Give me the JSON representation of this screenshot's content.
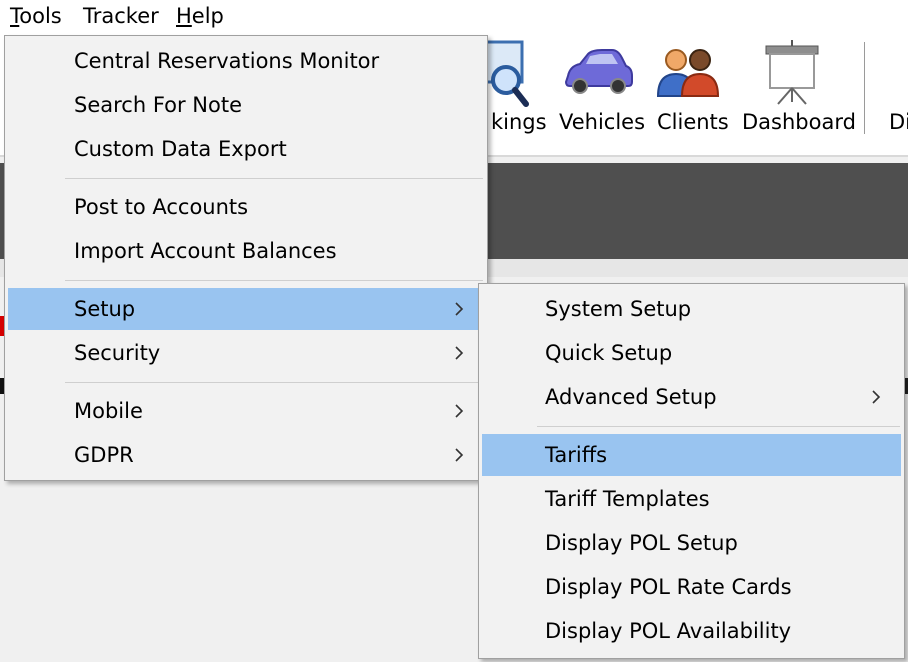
{
  "menubar": {
    "items": [
      {
        "label": "Tools",
        "mnemonic_first": "T",
        "rest": "ools"
      },
      {
        "label": "Tracker"
      },
      {
        "label": "Help",
        "mnemonic_first": "H",
        "rest": "elp"
      }
    ]
  },
  "toolbar": {
    "buttons": [
      {
        "label": "kings",
        "icon": "search-icon"
      },
      {
        "label": "Vehicles",
        "icon": "car-icon"
      },
      {
        "label": "Clients",
        "icon": "users-icon"
      },
      {
        "label": "Dashboard",
        "icon": "presentation-board-icon"
      },
      {
        "label": "Di"
      }
    ]
  },
  "tools_menu": {
    "groups": [
      [
        "Central Reservations Monitor",
        "Search For Note",
        "Custom Data Export"
      ],
      [
        "Post to Accounts",
        "Import Account Balances"
      ],
      [
        "Setup",
        "Security"
      ],
      [
        "Mobile",
        "GDPR"
      ]
    ],
    "highlighted": "Setup",
    "submenu_arrow_items": [
      "Setup",
      "Security",
      "Mobile",
      "GDPR"
    ]
  },
  "setup_submenu": {
    "groups": [
      [
        "System Setup",
        "Quick Setup",
        "Advanced Setup"
      ],
      [
        "Tariffs",
        "Tariff Templates",
        "Display POL Setup",
        "Display POL Rate Cards",
        "Display POL Availability"
      ]
    ],
    "highlighted": "Tariffs",
    "submenu_arrow_items": [
      "Advanced Setup"
    ]
  },
  "colors": {
    "highlight": "#99c4f0",
    "menu_bg": "#f2f2f2",
    "dark_band": "#4f4f4f",
    "accent_red": "#d40000"
  }
}
